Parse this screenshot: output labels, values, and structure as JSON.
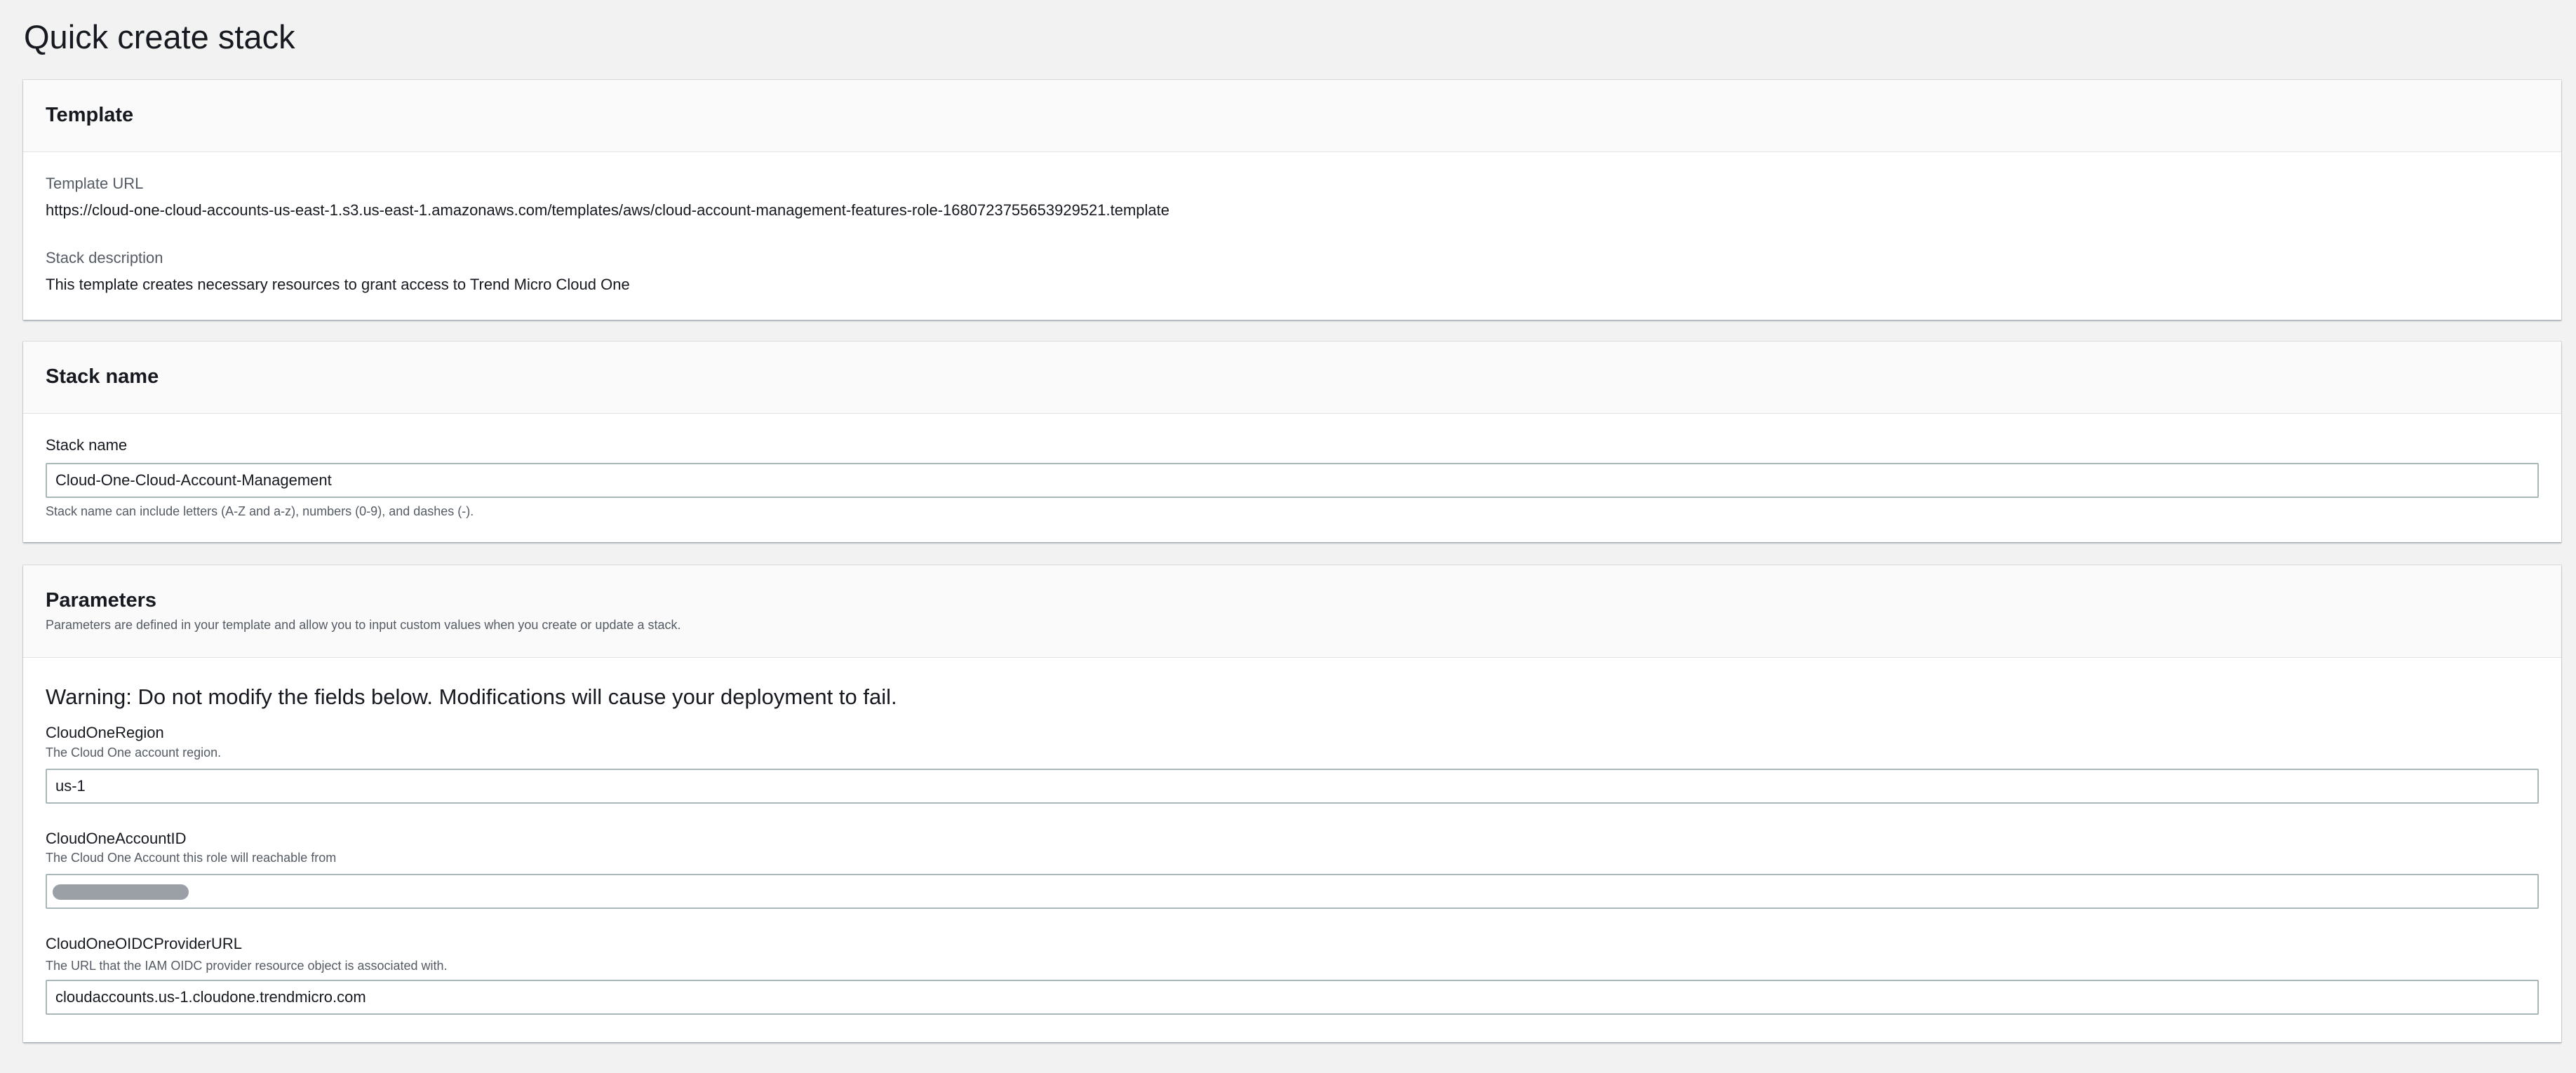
{
  "page": {
    "title": "Quick create stack"
  },
  "template_panel": {
    "title": "Template",
    "template_url_label": "Template URL",
    "template_url": "https://cloud-one-cloud-accounts-us-east-1.s3.us-east-1.amazonaws.com/templates/aws/cloud-account-management-features-role-1680723755653929521.template",
    "stack_description_label": "Stack description",
    "stack_description": "This template creates necessary resources to grant access to Trend Micro Cloud One"
  },
  "stack_name_panel": {
    "title": "Stack name",
    "field_label": "Stack name",
    "field_value": "Cloud-One-Cloud-Account-Management",
    "hint": "Stack name can include letters (A-Z and a-z), numbers (0-9), and dashes (-)."
  },
  "parameters_panel": {
    "title": "Parameters",
    "subtitle": "Parameters are defined in your template and allow you to input custom values when you create or update a stack.",
    "warning": "Warning: Do not modify the fields below. Modifications will cause your deployment to fail.",
    "fields": [
      {
        "label": "CloudOneRegion",
        "description": "The Cloud One account region.",
        "value": "us-1"
      },
      {
        "label": "CloudOneAccountID",
        "description": "The Cloud One Account this role will reachable from",
        "value": ""
      },
      {
        "label": "CloudOneOIDCProviderURL",
        "description": "The URL that the IAM OIDC provider resource object is associated with.",
        "value": "cloudaccounts.us-1.cloudone.trendmicro.com"
      }
    ]
  }
}
